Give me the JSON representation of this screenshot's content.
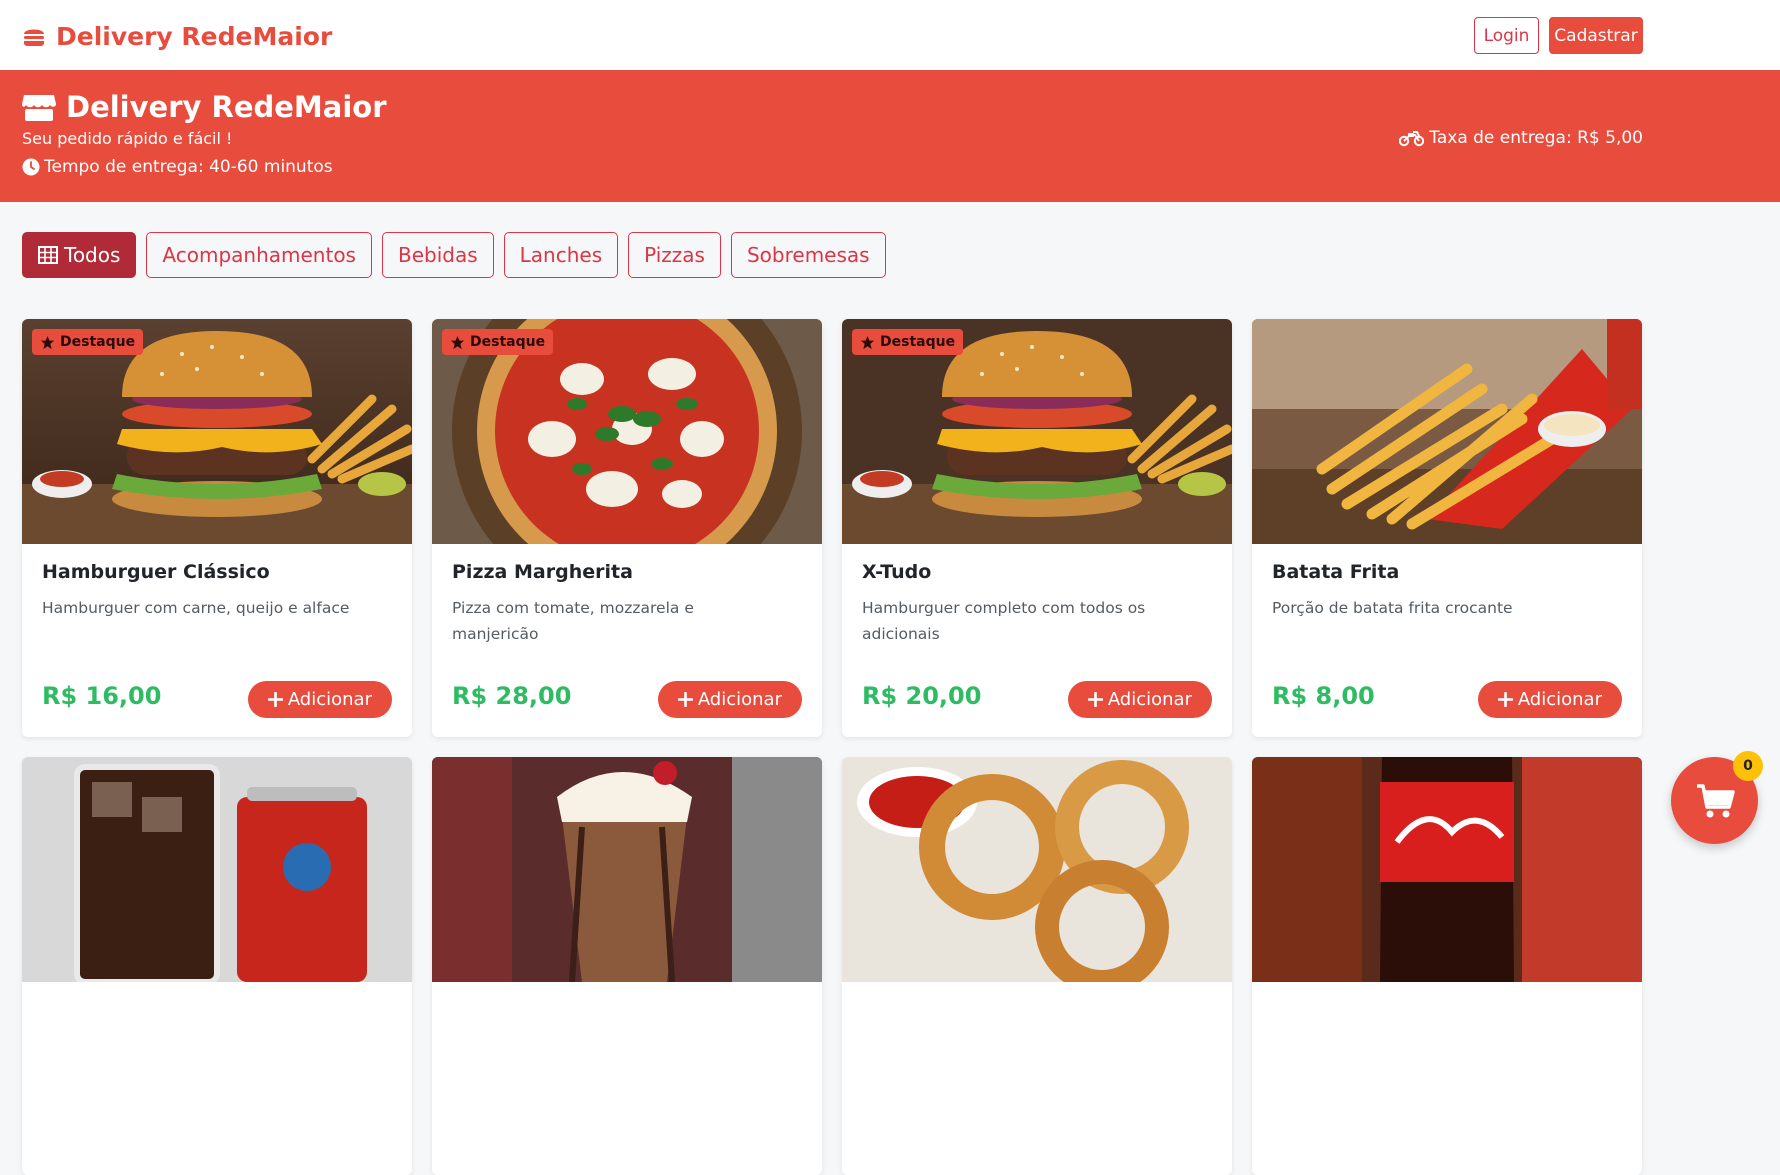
{
  "navbar": {
    "brand": "Delivery RedeMaior",
    "brand_icon": "burger-icon",
    "login": "Login",
    "signup": "Cadastrar"
  },
  "hero": {
    "title": "Delivery RedeMaior",
    "title_icon": "store-icon",
    "subtitle": "Seu pedido rápido e fácil !",
    "delivery_time": "Tempo de entrega: 40-60 minutos",
    "delivery_fee": "Taxa de entrega: R$ 5,00"
  },
  "filters": [
    {
      "label": "Todos",
      "active": true,
      "icon": "grid-icon"
    },
    {
      "label": "Acompanhamentos",
      "active": false
    },
    {
      "label": "Bebidas",
      "active": false
    },
    {
      "label": "Lanches",
      "active": false
    },
    {
      "label": "Pizzas",
      "active": false
    },
    {
      "label": "Sobremesas",
      "active": false
    }
  ],
  "products": [
    {
      "name": "Hamburguer Clássico",
      "desc": "Hamburguer com carne, queijo e alface",
      "price": "R$ 16,00",
      "badge": "Destaque",
      "image": "burger"
    },
    {
      "name": "Pizza Margherita",
      "desc": "Pizza com tomate, mozzarela e manjericão",
      "price": "R$ 28,00",
      "badge": "Destaque",
      "image": "pizza"
    },
    {
      "name": "X-Tudo",
      "desc": "Hamburguer completo com todos os adicionais",
      "price": "R$ 20,00",
      "badge": "Destaque",
      "image": "burger"
    },
    {
      "name": "Batata Frita",
      "desc": "Porção de batata frita crocante",
      "price": "R$ 8,00",
      "badge": "",
      "image": "fries"
    },
    {
      "name": "",
      "desc": "",
      "price": "",
      "badge": "",
      "image": "soda"
    },
    {
      "name": "",
      "desc": "",
      "price": "",
      "badge": "",
      "image": "milkshake"
    },
    {
      "name": "",
      "desc": "",
      "price": "",
      "badge": "",
      "image": "onion-rings"
    },
    {
      "name": "",
      "desc": "",
      "price": "",
      "badge": "",
      "image": "coca-cola"
    }
  ],
  "add_label": "Adicionar",
  "cart": {
    "count": "0"
  },
  "colors": {
    "primary": "#e84c3d",
    "active_filter": "#b02a37",
    "price": "#2fbb63",
    "badge_count": "#ffc107"
  }
}
